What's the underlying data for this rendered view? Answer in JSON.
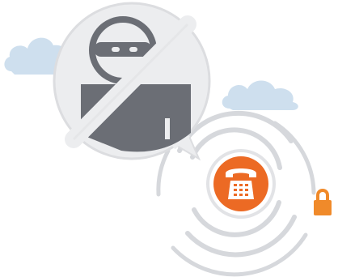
{
  "illustration": {
    "elements": {
      "prohibited_figure": "burglar-icon",
      "prohibition_symbol": "no-sign-icon",
      "phone": "telephone-icon",
      "lock": "padlock-icon",
      "clouds": "cloud-icon",
      "signal": "signal-rings"
    },
    "colors": {
      "background": "#ffffff",
      "cloud": "#c9dcec",
      "badge_fill": "#ecedef",
      "badge_border": "#dcdde0",
      "figure": "#6b6e75",
      "phone_accent": "#ec6a24",
      "lock_accent": "#f08a2a",
      "ring": "#d6d8dc"
    }
  }
}
